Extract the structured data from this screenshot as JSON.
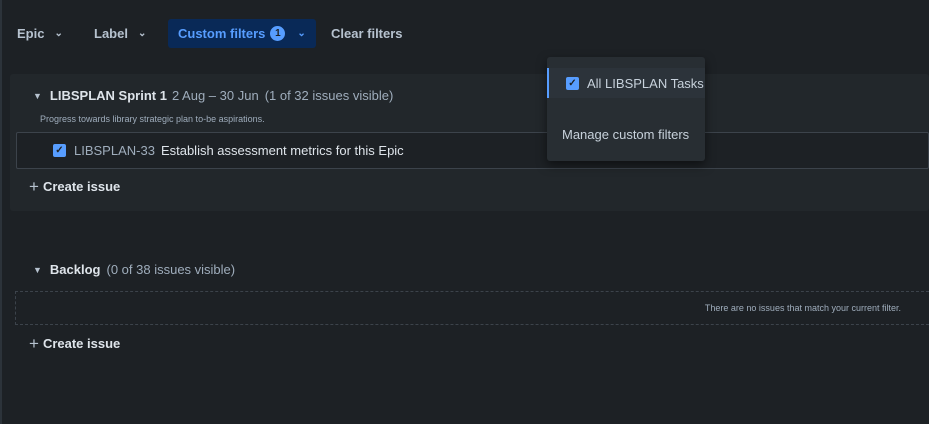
{
  "filters": {
    "epic_label": "Epic",
    "label_label": "Label",
    "custom_label": "Custom filters",
    "custom_count": "1",
    "clear_label": "Clear filters"
  },
  "sprint": {
    "name": "LIBSPLAN Sprint 1",
    "dates": "2 Aug – 30 Jun",
    "visible": "(1 of 32 issues visible)",
    "goal": "Progress towards library strategic plan to-be aspirations.",
    "issue": {
      "key": "LIBSPLAN-33",
      "summary": "Establish assessment metrics for this Epic"
    },
    "create_label": "Create issue"
  },
  "backlog": {
    "name": "Backlog",
    "visible": "(0 of 38 issues visible)",
    "empty_text": "There are no issues that match your current filter.",
    "create_label": "Create issue"
  },
  "dropdown": {
    "item_label": "All LIBSPLAN Tasks",
    "manage_label": "Manage custom filters"
  },
  "colors": {
    "accent": "#579dff",
    "background": "#1d2125",
    "panel": "#22272b"
  }
}
